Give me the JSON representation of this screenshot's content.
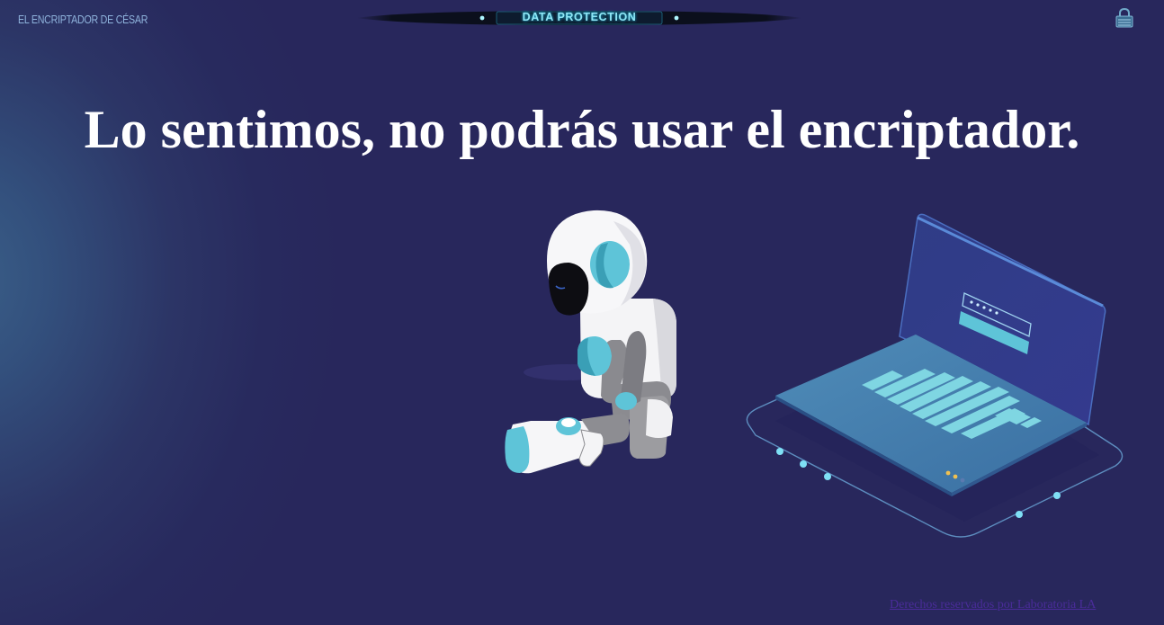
{
  "header": {
    "brand": "EL ENCRIPTADOR DE CÉSAR",
    "banner_text": "DATA PROTECTION",
    "lock_icon": "padlock-icon"
  },
  "main": {
    "headline": "Lo sentimos, no podrás usar el encriptador.",
    "illustration_robot": "sad-robot-illustration",
    "illustration_laptop": "laptop-login-illustration"
  },
  "footer": {
    "copyright_link": "Derechos reservados por Laboratoria LA"
  },
  "colors": {
    "background": "#28275c",
    "headline": "#ffffff",
    "accent_cyan": "#5ec4d8",
    "footer_link": "#4a2c9a"
  }
}
